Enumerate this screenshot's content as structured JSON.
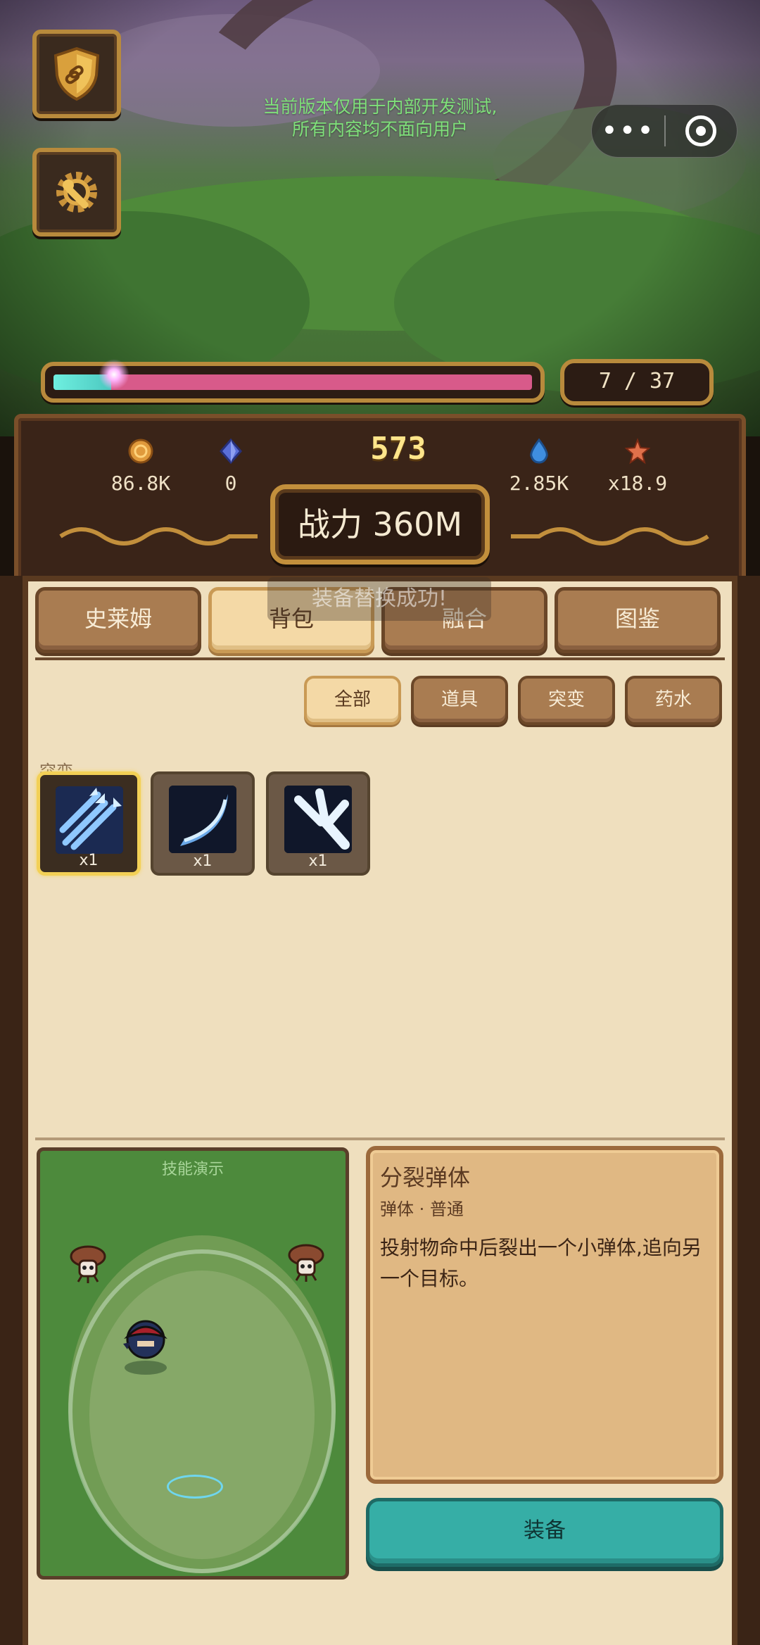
{
  "top": {
    "dev_notice_line1": "当前版本仅用于内部开发测试,",
    "dev_notice_line2": "所有内容均不面向用户",
    "capsule_more": "•••",
    "xp_progress": 0.12,
    "wave": "7 / 37"
  },
  "resources": {
    "coins": "86.8K",
    "gems_small": "0",
    "gems_big": "573",
    "water": "2.85K",
    "multiplier": "x18.9"
  },
  "power": "战力 360M",
  "toast": "装备替换成功!",
  "tabs": [
    "史莱姆",
    "背包",
    "融合",
    "图鉴"
  ],
  "filters": [
    "全部",
    "道具",
    "突变",
    "药水"
  ],
  "section_label": "突变",
  "items": [
    {
      "icon": "split-arrows-icon",
      "count": "x1"
    },
    {
      "icon": "crescent-slash-icon",
      "count": "x1"
    },
    {
      "icon": "spread-shot-icon",
      "count": "x1"
    }
  ],
  "demo": {
    "title": "技能演示"
  },
  "info": {
    "name": "分裂弹体",
    "meta": "弹体 · 普通",
    "desc": "投射物命中后裂出一个小弹体,追向另一个目标。"
  },
  "equip_label": "装备",
  "colors": {
    "accent": "#36aea6",
    "panel": "#efdfbe",
    "frame": "#b88a3c"
  }
}
